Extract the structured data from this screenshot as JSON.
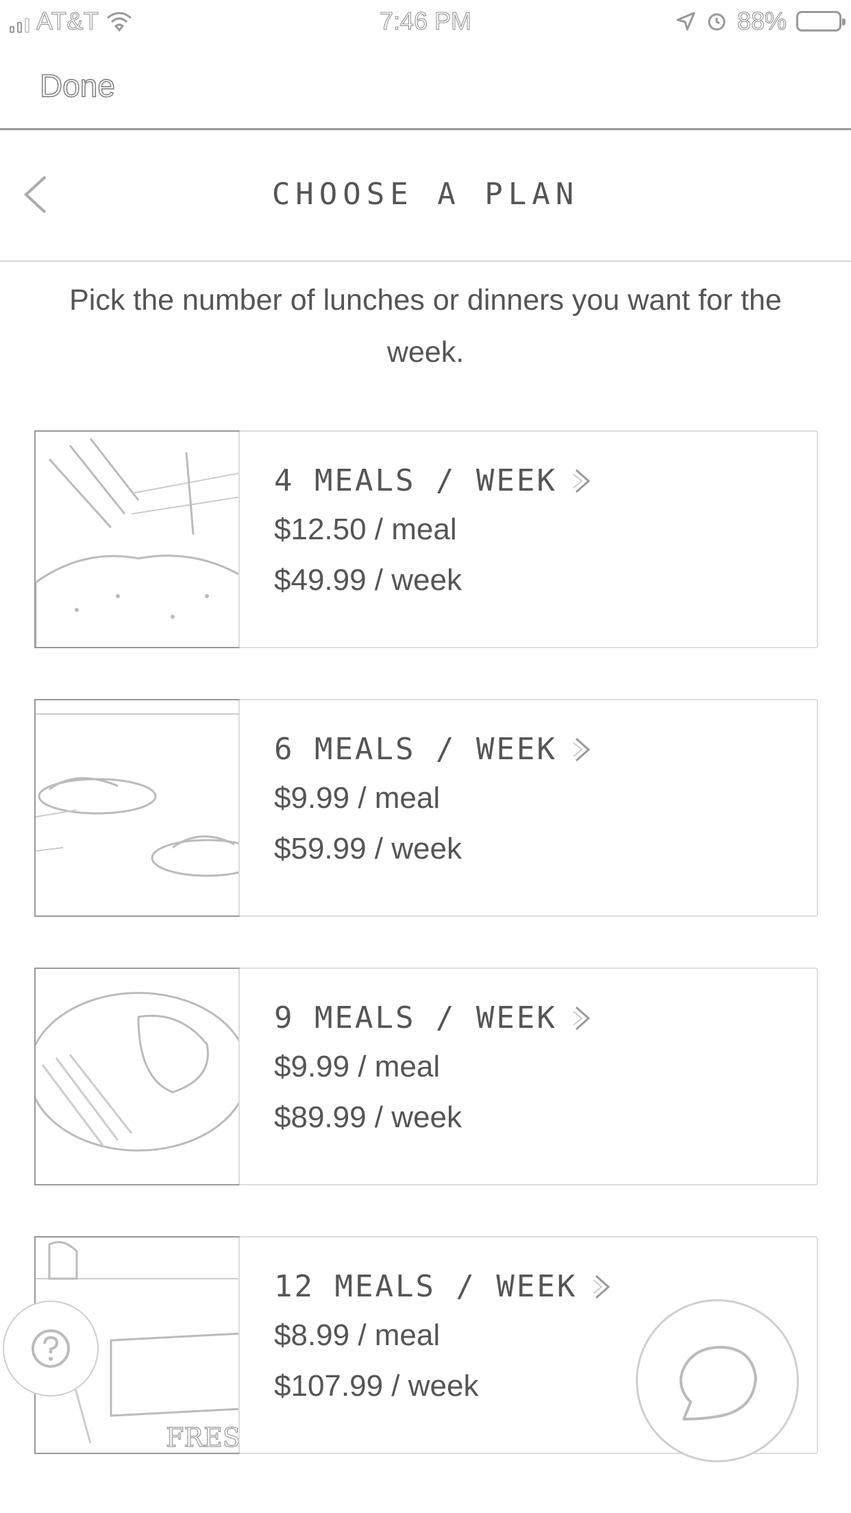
{
  "status_bar": {
    "carrier": "AT&T",
    "time": "7:46 PM",
    "battery": "88%",
    "icons": [
      "signal-icon",
      "wifi-icon",
      "location-icon",
      "alarm-icon",
      "battery-icon"
    ]
  },
  "nav": {
    "done_label": "Done"
  },
  "header": {
    "title": "CHOOSE A PLAN",
    "back_icon": "chevron-left-icon"
  },
  "intro": "Pick the number of lunches or dinners you want for the week.",
  "plans": [
    {
      "name": "4 MEALS / WEEK",
      "price_meal": "$12.50 / meal",
      "price_week": "$49.99 / week",
      "image": "food-photo-seasoning"
    },
    {
      "name": "6 MEALS / WEEK",
      "price_meal": "$9.99 / meal",
      "price_week": "$59.99 / week",
      "image": "food-photo-plates"
    },
    {
      "name": "9 MEALS / WEEK",
      "price_meal": "$9.99 / meal",
      "price_week": "$89.99 / week",
      "image": "food-photo-dish"
    },
    {
      "name": "12 MEALS / WEEK",
      "price_meal": "$8.99 / meal",
      "price_week": "$107.99 / week",
      "image": "food-photo-delivery-box",
      "image_text": "FRESHLY"
    }
  ],
  "floating": {
    "help_icon": "question-icon",
    "chat_icon": "chat-bubble-icon"
  },
  "colors": {
    "text": "#555555",
    "border": "#dddddd",
    "line": "#999999"
  }
}
